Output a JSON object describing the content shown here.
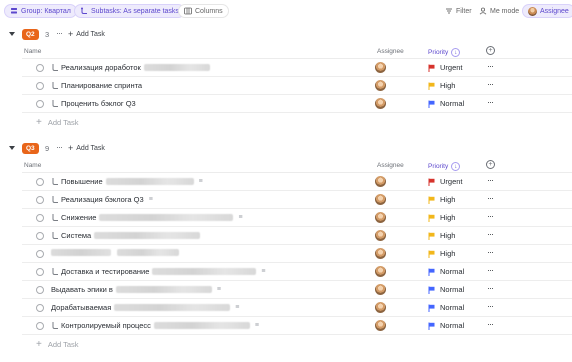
{
  "toolbar": {
    "group_chip": "Group: Квартал",
    "subtasks_chip": "Subtasks: As separate tasks",
    "columns_chip": "Columns",
    "filter": "Filter",
    "me_mode": "Me mode",
    "assignee": "Assignee"
  },
  "columns": {
    "name": "Name",
    "assignee": "Assignee",
    "priority": "Priority",
    "sort_glyph": "↓",
    "add_glyph": "+"
  },
  "add_task_label": "Add Task",
  "add_glyph": "+",
  "more_glyph": "···",
  "desc_glyph": "≡",
  "priority_colors": {
    "Urgent": "#d6332c",
    "High": "#f2b71b",
    "Normal": "#4466ff"
  },
  "groups": [
    {
      "badge": "Q2",
      "count": "3",
      "tasks": [
        {
          "title": "Реализация доработок",
          "subtask": true,
          "priority": "Urgent"
        },
        {
          "title": "Планирование спринта",
          "subtask": true,
          "priority": "High"
        },
        {
          "title": "Проценить бэклог Q3",
          "subtask": true,
          "priority": "Normal"
        }
      ]
    },
    {
      "badge": "Q3",
      "count": "9",
      "tasks": [
        {
          "title": "Повышение",
          "subtask": true,
          "priority": "Urgent"
        },
        {
          "title": "Реализация бэклога Q3",
          "subtask": true,
          "priority": "High"
        },
        {
          "title": "Снижение",
          "subtask": true,
          "priority": "High"
        },
        {
          "title": "Система",
          "subtask": true,
          "priority": "High"
        },
        {
          "title": "",
          "subtask": false,
          "priority": "High"
        },
        {
          "title": "Доставка и тестирование",
          "subtask": true,
          "priority": "Normal"
        },
        {
          "title": "Выдавать эпики в",
          "subtask": false,
          "priority": "Normal"
        },
        {
          "title": "Дорабатываемая",
          "subtask": false,
          "priority": "Normal"
        },
        {
          "title": "Контролируемый процесс",
          "subtask": true,
          "priority": "Normal"
        }
      ]
    }
  ]
}
